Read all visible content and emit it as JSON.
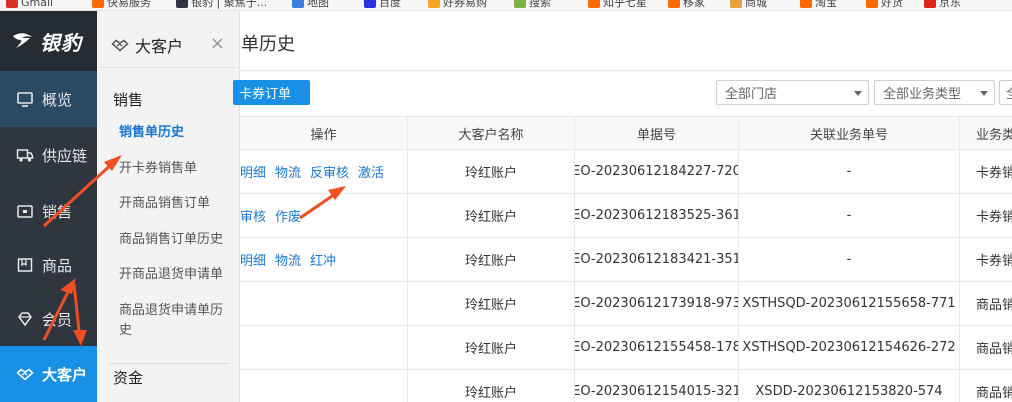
{
  "bookmarks": [
    {
      "label": "Gmail",
      "color": "#d93025"
    },
    {
      "label": "快易服务",
      "color": "#ff6a00"
    },
    {
      "label": "银豹 | 聚焦于...",
      "color": "#2f3640"
    },
    {
      "label": "地图",
      "color": "#3b7ddd"
    },
    {
      "label": "百度",
      "color": "#2932e1"
    },
    {
      "label": "好券易购",
      "color": "#f5a623"
    },
    {
      "label": "搜索",
      "color": "#7cb342"
    },
    {
      "label": "知乎七星",
      "color": "#ff6a00"
    },
    {
      "label": "移家",
      "color": "#ff6a00"
    },
    {
      "label": "商城",
      "color": "#e6a23c"
    },
    {
      "label": "淘宝",
      "color": "#ff6a00"
    },
    {
      "label": "好货",
      "color": "#ff6a00"
    },
    {
      "label": "京东",
      "color": "#e1251b"
    }
  ],
  "logo": {
    "text": "银豹"
  },
  "nav": {
    "items": [
      {
        "label": "概览",
        "icon": "monitor-icon"
      },
      {
        "label": "供应链",
        "icon": "truck-icon"
      },
      {
        "label": "销售",
        "icon": "wallet-icon"
      },
      {
        "label": "商品",
        "icon": "book-icon"
      },
      {
        "label": "会员",
        "icon": "diamond-icon"
      },
      {
        "label": "大客户",
        "icon": "handshake-icon"
      }
    ],
    "active_color": "#1890e6"
  },
  "submenu": {
    "title": "大客户",
    "close": "×",
    "group1": "销售",
    "items": [
      "销售单历史",
      "开卡券销售单",
      "开商品销售订单",
      "商品销售订单历史",
      "开商品退货申请单",
      "商品退货申请单历史"
    ],
    "group2": "资金"
  },
  "main": {
    "title": "单历史",
    "action_button": "卡券订单",
    "filters": [
      "全部门店",
      "全部业务类型",
      "全部"
    ],
    "columns": [
      "操作",
      "大客户名称",
      "单据号",
      "关联业务单号",
      "业务类"
    ],
    "rows": [
      {
        "ops": [
          "明细",
          "物流",
          "反审核",
          "激活"
        ],
        "customer": "玲红账户",
        "doc": "EO-20230612184227-720",
        "related": "-",
        "type": "卡券销"
      },
      {
        "ops": [
          "审核",
          "作废"
        ],
        "customer": "玲红账户",
        "doc": "EO-20230612183525-361",
        "related": "-",
        "type": "卡券销"
      },
      {
        "ops": [
          "明细",
          "物流",
          "红冲"
        ],
        "customer": "玲红账户",
        "doc": "EO-20230612183421-351",
        "related": "-",
        "type": "卡券销"
      },
      {
        "ops": [],
        "customer": "玲红账户",
        "doc": "EO-20230612173918-973",
        "related": "XSTHSQD-20230612155658-771",
        "type": "商品销"
      },
      {
        "ops": [],
        "customer": "玲红账户",
        "doc": "EO-20230612155458-178",
        "related": "XSTHSQD-20230612154626-272",
        "type": "商品销"
      },
      {
        "ops": [],
        "customer": "玲红账户",
        "doc": "EO-20230612154015-321",
        "related": "XSDD-20230612153820-574",
        "type": "商品销"
      }
    ]
  },
  "colors": {
    "accent": "#1890e6",
    "link": "#1a78d0",
    "nav_bg": "#2f3640",
    "arrow": "#f04e23"
  }
}
